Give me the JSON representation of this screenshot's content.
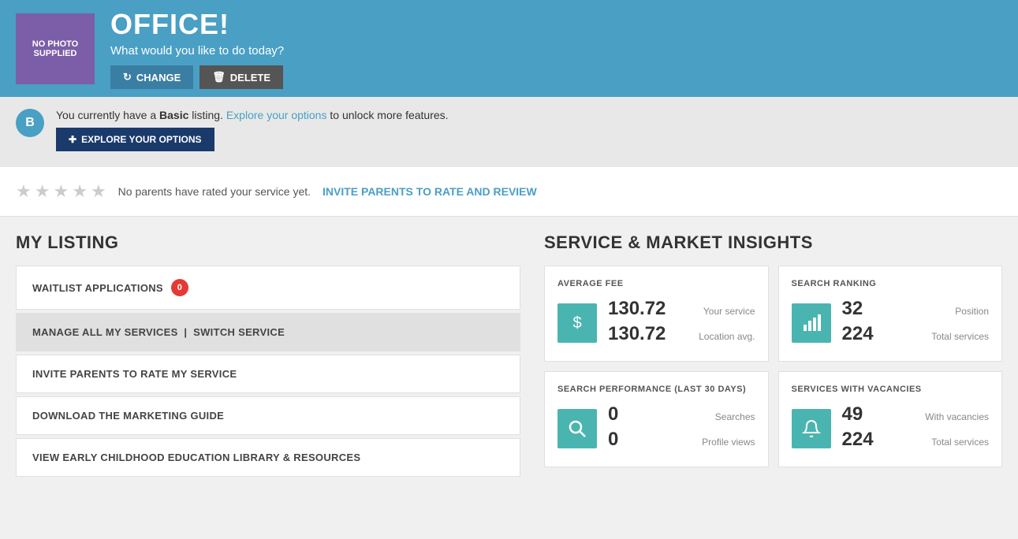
{
  "header": {
    "photo_text": "NO PHOTO\nSUPPLIED",
    "title": "OFFICE!",
    "subtitle": "What would you like to do today?",
    "btn_change": "CHANGE",
    "btn_delete": "DELETE"
  },
  "listing_banner": {
    "badge_letter": "B",
    "text_before": "You currently have a ",
    "listing_type": "Basic",
    "text_middle": " listing.",
    "link_text": "Explore your options",
    "text_after": " to unlock more features.",
    "btn_explore": "EXPLORE YOUR OPTIONS"
  },
  "ratings": {
    "no_ratings_text": "No parents have rated your service yet.",
    "invite_link": "INVITE PARENTS TO RATE AND REVIEW"
  },
  "my_listing": {
    "title": "MY LISTING",
    "menu_items": [
      {
        "label": "WAITLIST APPLICATIONS",
        "badge": "0",
        "highlighted": false
      },
      {
        "label": "MANAGE ALL MY SERVICES  |  SWITCH SERVICE",
        "badge": null,
        "highlighted": true
      },
      {
        "label": "INVITE PARENTS TO RATE MY SERVICE",
        "badge": null,
        "highlighted": false
      },
      {
        "label": "DOWNLOAD THE MARKETING GUIDE",
        "badge": null,
        "highlighted": false
      },
      {
        "label": "VIEW EARLY CHILDHOOD EDUCATION LIBRARY & RESOURCES",
        "badge": null,
        "highlighted": false
      }
    ]
  },
  "insights": {
    "title": "SERVICE & MARKET INSIGHTS",
    "cards": [
      {
        "id": "average-fee",
        "title": "AVERAGE FEE",
        "icon": "$",
        "rows": [
          {
            "number": "130.72",
            "label": "Your service"
          },
          {
            "number": "130.72",
            "label": "Location avg."
          }
        ]
      },
      {
        "id": "search-ranking",
        "title": "SEARCH RANKING",
        "icon": "▦",
        "rows": [
          {
            "number": "32",
            "label": "Position"
          },
          {
            "number": "224",
            "label": "Total services"
          }
        ]
      },
      {
        "id": "search-performance",
        "title": "SEARCH PERFORMANCE (LAST 30 DAYS)",
        "icon": "🔍",
        "rows": [
          {
            "number": "0",
            "label": "Searches"
          },
          {
            "number": "0",
            "label": "Profile views"
          }
        ]
      },
      {
        "id": "services-vacancies",
        "title": "SERVICES WITH VACANCIES",
        "icon": "🔔",
        "rows": [
          {
            "number": "49",
            "label": "With vacancies"
          },
          {
            "number": "224",
            "label": "Total services"
          }
        ]
      }
    ]
  }
}
